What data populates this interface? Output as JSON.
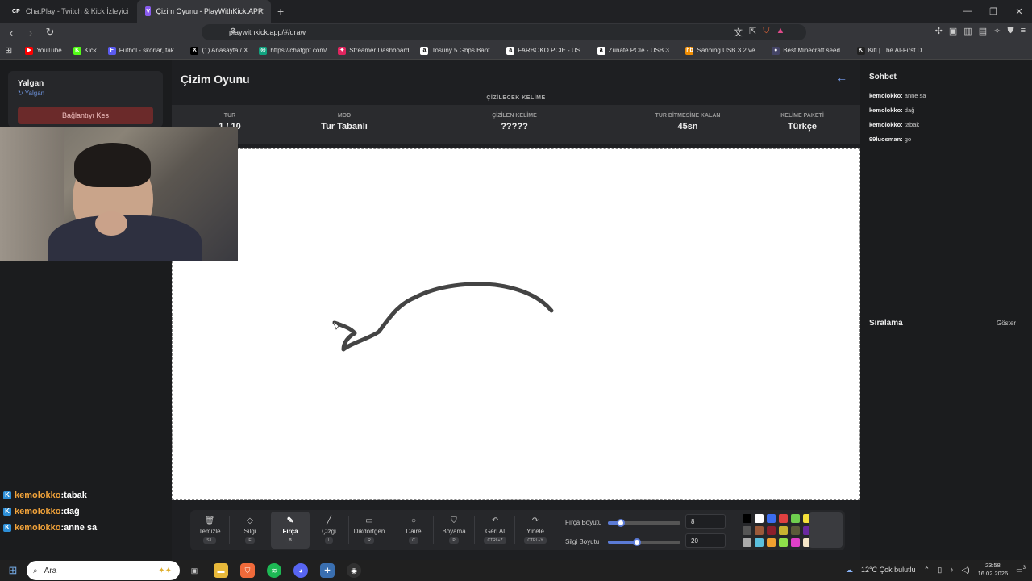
{
  "browser": {
    "tabs": [
      {
        "favicon": "CP",
        "label": "ChatPlay - Twitch & Kick İzleyici Etkil"
      },
      {
        "favicon": "V",
        "label": "Çizim Oyunu - PlayWithKick.APP"
      }
    ],
    "new_tab": "+",
    "url": "playwithkick.app/#/draw",
    "bookmarks": [
      {
        "label": "YouTube",
        "color": "#ff0000",
        "icon": "▶"
      },
      {
        "label": "Kick",
        "color": "#53fc18",
        "icon": "K"
      },
      {
        "label": "Futbol - skorlar, tak...",
        "color": "#5b5bf0",
        "icon": "F"
      },
      {
        "label": "(1) Anasayfa / X",
        "color": "#000000",
        "icon": "X"
      },
      {
        "label": "https://chatgpt.com/",
        "color": "#10a37f",
        "icon": "◎"
      },
      {
        "label": "Streamer Dashboard",
        "color": "#e0245e",
        "icon": "✦"
      },
      {
        "label": "Tosuny 5 Gbps Bant...",
        "color": "#ffffff",
        "icon": "a"
      },
      {
        "label": "FARBOKO PCIE - US...",
        "color": "#ffffff",
        "icon": "a"
      },
      {
        "label": "Zunate PCIe - USB 3...",
        "color": "#ffffff",
        "icon": "a"
      },
      {
        "label": "Sanning USB 3.2 ve...",
        "color": "#f08c00",
        "icon": "hb"
      },
      {
        "label": "Best Minecraft seed...",
        "color": "#444466",
        "icon": "●"
      },
      {
        "label": "Kitl | The AI-First D...",
        "color": "#222222",
        "icon": "K"
      }
    ]
  },
  "left": {
    "user_name": "Yalgan",
    "user_link": "Yalgan",
    "disconnect_label": "Bağlantıyı Kes"
  },
  "overlay_chat": [
    {
      "user": "kemolokko",
      "sep": " : ",
      "msg": "tabak"
    },
    {
      "user": "kemolokko",
      "sep": " : ",
      "msg": "dağ"
    },
    {
      "user": "kemolokko",
      "sep": " : ",
      "msg": "anne sa"
    }
  ],
  "game": {
    "title": "Çizim Oyunu",
    "word_label": "ÇİZİLECEK KELİME",
    "stats": {
      "round_label": "TUR",
      "round_value": "1 / 10",
      "mode_label": "MOD",
      "mode_value": "Tur Tabanlı",
      "word_label": "ÇİZİLEN KELİME",
      "word_value": "?????",
      "time_label": "TUR BİTMESİNE KALAN",
      "time_value": "45sn",
      "pack_label": "KELİME PAKETİ",
      "pack_value": "Türkçe"
    }
  },
  "tools": [
    {
      "icon": "🗑",
      "label": "Temizle",
      "key": "SIL"
    },
    {
      "icon": "◇",
      "label": "Silgi",
      "key": "E"
    },
    {
      "icon": "✎",
      "label": "Fırça",
      "key": "B"
    },
    {
      "icon": "╱",
      "label": "Çizgi",
      "key": "L"
    },
    {
      "icon": "▭",
      "label": "Dikdörtgen",
      "key": "R"
    },
    {
      "icon": "○",
      "label": "Daire",
      "key": "C"
    },
    {
      "icon": "⛉",
      "label": "Boyama",
      "key": "P"
    },
    {
      "icon": "↶",
      "label": "Geri Al",
      "key": "CTRL+Z"
    },
    {
      "icon": "↷",
      "label": "Yinele",
      "key": "CTRL+Y"
    }
  ],
  "sliders": {
    "brush_label": "Fırça Boyutu",
    "brush_value": "8",
    "brush_fraction": 0.18,
    "eraser_label": "Silgi Boyutu",
    "eraser_value": "20",
    "eraser_fraction": 0.4
  },
  "palette": [
    "#000000",
    "#ffffff",
    "#3b6df0",
    "#e04040",
    "#6fcf4f",
    "#f5e03a",
    "#555555",
    "#9b5a3a",
    "#8b1e2b",
    "#c8b430",
    "#5b5b3a",
    "#6a28a0",
    "#aaaaaa",
    "#5bc0de",
    "#f0a030",
    "#8ee04a",
    "#e040c8",
    "#f5e6c8"
  ],
  "chat": {
    "title": "Sohbet",
    "messages": [
      {
        "user": "kemolokko:",
        "msg": "anne sa"
      },
      {
        "user": "kemolokko:",
        "msg": "dağ"
      },
      {
        "user": "kemolokko:",
        "msg": "tabak"
      },
      {
        "user": "99luosman:",
        "msg": "go"
      }
    ],
    "ranking_title": "Sıralama",
    "ranking_button": "Göster"
  },
  "taskbar": {
    "search_placeholder": "Ara",
    "weather": "12°C  Çok bulutlu",
    "time": "23:58",
    "date": "16.02.2026",
    "notif_count": "3"
  }
}
